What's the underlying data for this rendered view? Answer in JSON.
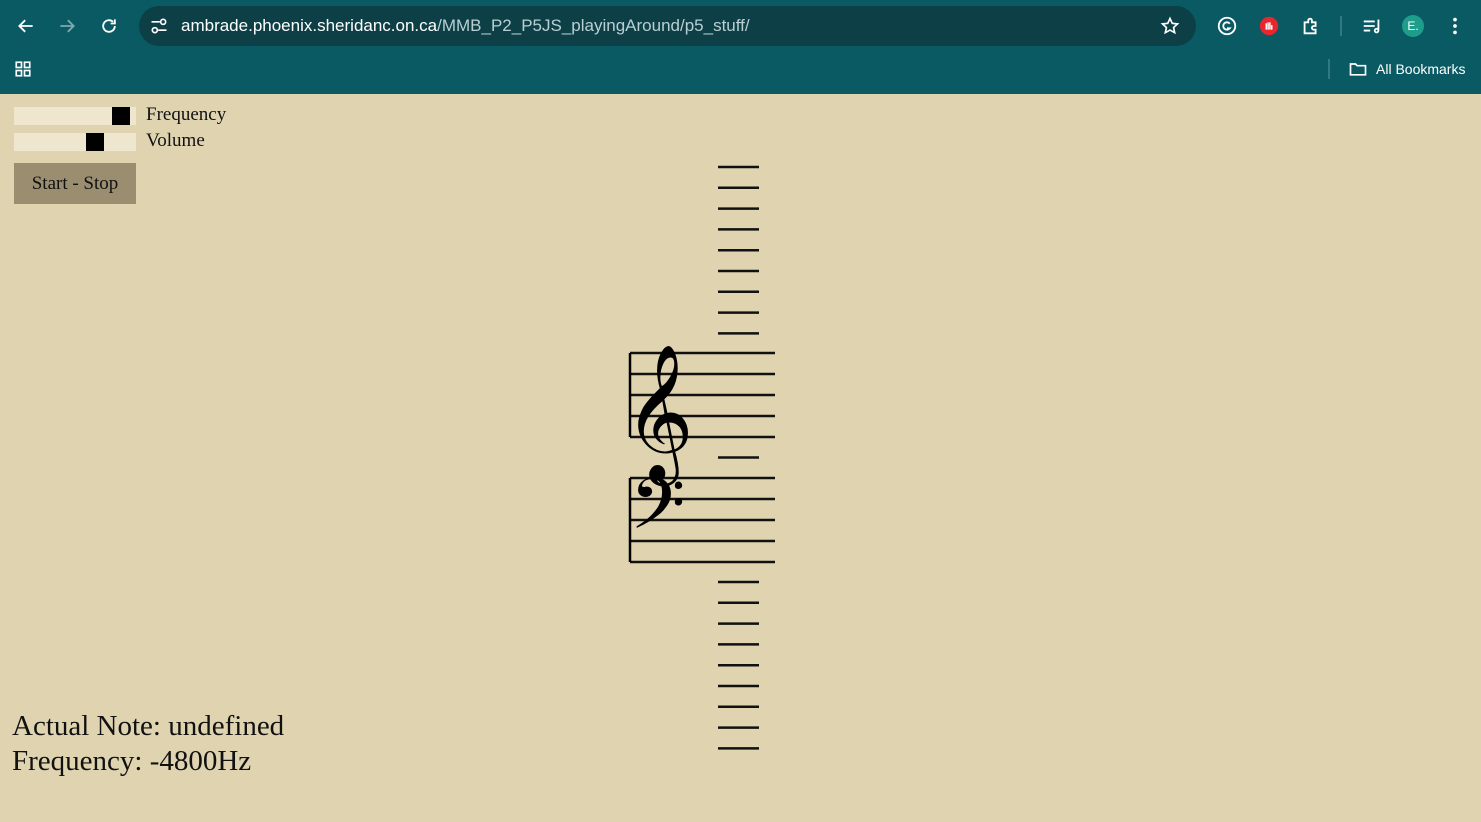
{
  "browser": {
    "url_host": "ambrade.phoenix.sheridanc.on.ca",
    "url_path": "/MMB_P2_P5JS_playingAround/p5_stuff/",
    "profile_initial": "E.",
    "bookmarks_label": "All Bookmarks",
    "icons": [
      "back-icon",
      "forward-icon",
      "reload-icon",
      "site-info-icon",
      "star-icon",
      "grammarly-icon",
      "adblock-icon",
      "extensions-icon",
      "media-icon",
      "menu-icon",
      "apps-icon",
      "folder-icon"
    ]
  },
  "controls": {
    "frequency_label": "Frequency",
    "frequency_value": 0.88,
    "volume_label": "Volume",
    "volume_value": 0.66,
    "button_label": "Start - Stop"
  },
  "staff": {
    "treble_clef": "𝄞",
    "bass_clef": "𝄢"
  },
  "readout": {
    "note_text": "Actual Note: undefined",
    "frequency_text": "Frequency: -4800Hz"
  },
  "colors": {
    "chrome": "#0a5a63",
    "omnibox": "#0d3f47",
    "page_bg": "#e0d4b0",
    "slider_track": "#efe6d0",
    "button_bg": "#9b8e70"
  }
}
